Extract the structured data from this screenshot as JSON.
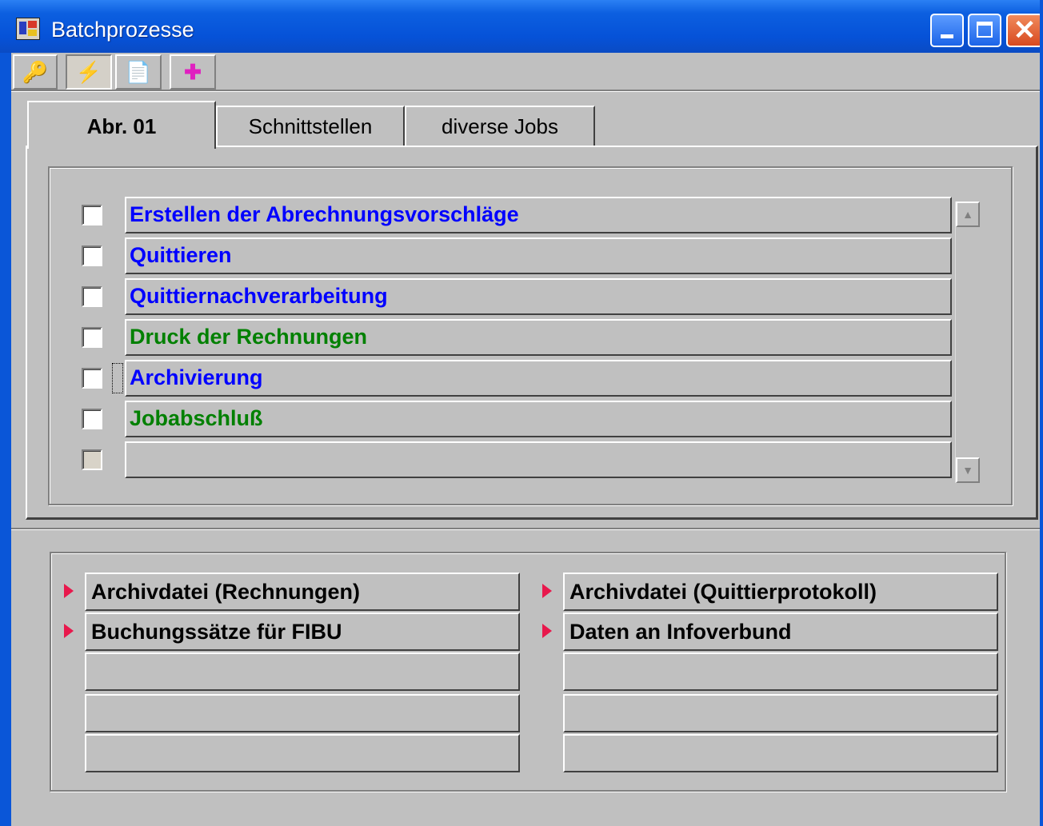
{
  "window": {
    "title": "Batchprozesse",
    "close_glyph": "✕"
  },
  "toolbar": {
    "key_icon": "🔑",
    "flash_icon": "⚡",
    "doc_icon": "📄",
    "puzzle_icon": "✚"
  },
  "tabs": [
    {
      "label": "Abr. 01",
      "active": true
    },
    {
      "label": "Schnittstellen",
      "active": false
    },
    {
      "label": "diverse Jobs",
      "active": false
    }
  ],
  "jobs": [
    {
      "label": "Erstellen der Abrechnungsvorschläge",
      "color": "#0000ff"
    },
    {
      "label": "Quittieren",
      "color": "#0000ff"
    },
    {
      "label": "Quittiernachverarbeitung",
      "color": "#0000ff"
    },
    {
      "label": "Druck der Rechnungen",
      "color": "#008000"
    },
    {
      "label": "Archivierung",
      "color": "#0000ff"
    },
    {
      "label": "Jobabschluß",
      "color": "#008000"
    },
    {
      "label": "",
      "color": "#000000"
    }
  ],
  "scroll": {
    "up": "▲",
    "down": "▼"
  },
  "outputs_left": [
    {
      "label": "Archivdatei (Rechnungen)"
    },
    {
      "label": "Buchungssätze für FIBU"
    },
    {
      "label": ""
    },
    {
      "label": ""
    },
    {
      "label": ""
    }
  ],
  "outputs_right": [
    {
      "label": "Archivdatei (Quittierprotokoll)"
    },
    {
      "label": "Daten an Infoverbund"
    },
    {
      "label": ""
    },
    {
      "label": ""
    },
    {
      "label": ""
    }
  ]
}
